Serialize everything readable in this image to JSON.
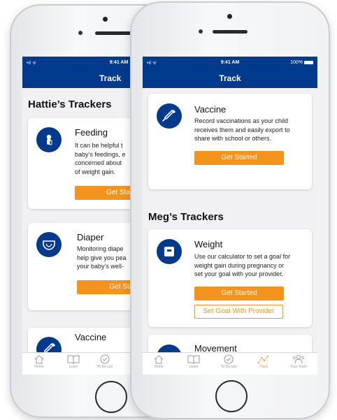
{
  "back_phone": {
    "status": {
      "signal": "•ıl ᯤ",
      "time": "9:41 AM"
    },
    "nav_title": "Track",
    "section_title": "Hattie’s Trackers",
    "cards": [
      {
        "title": "Feeding",
        "desc": [
          "It can be helpful t",
          "baby’s feedings, e",
          "concerned about",
          "of weight gain."
        ],
        "button": "Get Start",
        "icon": "baby-bottle-icon"
      },
      {
        "title": "Diaper",
        "desc": [
          "Monitoring diape",
          "help give you pea",
          "your baby’s well-"
        ],
        "button": "Get Star",
        "icon": "diaper-icon"
      },
      {
        "title": "Vaccine",
        "icon": "syringe-icon"
      }
    ],
    "tabs": [
      {
        "label": "Home",
        "icon": "home-icon"
      },
      {
        "label": "Learn",
        "icon": "book-icon"
      },
      {
        "label": "To Do List",
        "icon": "checkmark-icon"
      }
    ]
  },
  "front_phone": {
    "status": {
      "signal": "•ıl ᯤ",
      "time": "9:41 AM",
      "battery": "100%"
    },
    "nav_title": "Track",
    "vaccine_card": {
      "title": "Vaccine",
      "desc": [
        "Record vaccinations as your child",
        "receives them and easily export to",
        "share with school or others."
      ],
      "button": "Get Started",
      "icon": "syringe-icon"
    },
    "section_title": "Meg’s Trackers",
    "weight_card": {
      "title": "Weight",
      "desc": [
        "Use our calculator to set a goal for",
        "weight gain during pregnancy or",
        "set your goal with your provider."
      ],
      "button": "Get Started",
      "button2": "Set Goal With Provider",
      "icon": "scale-icon"
    },
    "movement_card": {
      "title": "Movement"
    },
    "tabs": [
      {
        "label": "Home",
        "icon": "home-icon"
      },
      {
        "label": "Learn",
        "icon": "book-icon"
      },
      {
        "label": "To Do List",
        "icon": "checkmark-icon"
      },
      {
        "label": "Track",
        "icon": "track-graph-icon",
        "active": true
      },
      {
        "label": "Your Team",
        "icon": "team-icon"
      }
    ]
  },
  "colors": {
    "brand_blue": "#003a8c",
    "accent_orange": "#f5931f",
    "background": "#f1f1f4"
  }
}
